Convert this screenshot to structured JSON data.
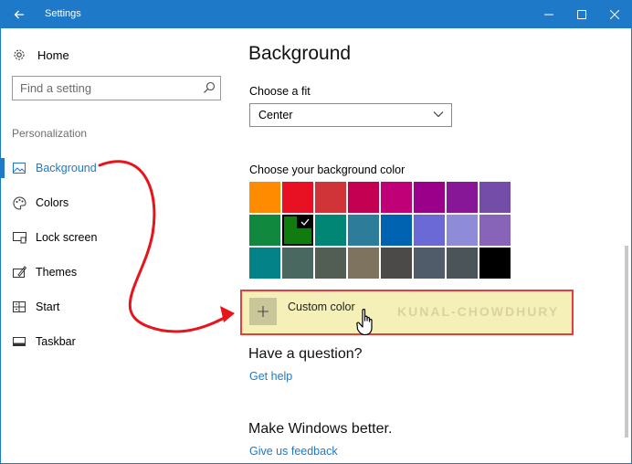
{
  "window": {
    "title": "Settings"
  },
  "sidebar": {
    "home_label": "Home",
    "search_placeholder": "Find a setting",
    "section_label": "Personalization",
    "items": [
      {
        "label": "Background",
        "icon": "picture-icon",
        "active": true
      },
      {
        "label": "Colors",
        "icon": "palette-icon",
        "active": false
      },
      {
        "label": "Lock screen",
        "icon": "lock-screen-icon",
        "active": false
      },
      {
        "label": "Themes",
        "icon": "themes-icon",
        "active": false
      },
      {
        "label": "Start",
        "icon": "start-icon",
        "active": false
      },
      {
        "label": "Taskbar",
        "icon": "taskbar-icon",
        "active": false
      }
    ]
  },
  "main": {
    "title": "Background",
    "fit_label": "Choose a fit",
    "fit_value": "Center",
    "color_label": "Choose your background color",
    "swatches": [
      "#ff8c00",
      "#e81123",
      "#d13438",
      "#c30052",
      "#bf0077",
      "#9a0089",
      "#881798",
      "#744da9",
      "#10893e",
      "#107c10",
      "#018574",
      "#2d7d9a",
      "#0063b1",
      "#6b69d6",
      "#8e8cd8",
      "#8764b8",
      "#038387",
      "#486860",
      "#525e54",
      "#7e735f",
      "#4c4a48",
      "#515c6b",
      "#4a5459",
      "#000000"
    ],
    "selected_swatch": 9,
    "custom_color_label": "Custom color",
    "watermark": "KUNAL-CHOWDHURY",
    "question_title": "Have a question?",
    "help_link": "Get help",
    "better_title": "Make Windows better.",
    "feedback_link": "Give us feedback"
  },
  "colors": {
    "accent": "#1e7ac9",
    "highlight_border": "#e53c3c",
    "highlight_fill": "#f4f0b8",
    "annotation_arrow": "#e8131b"
  }
}
